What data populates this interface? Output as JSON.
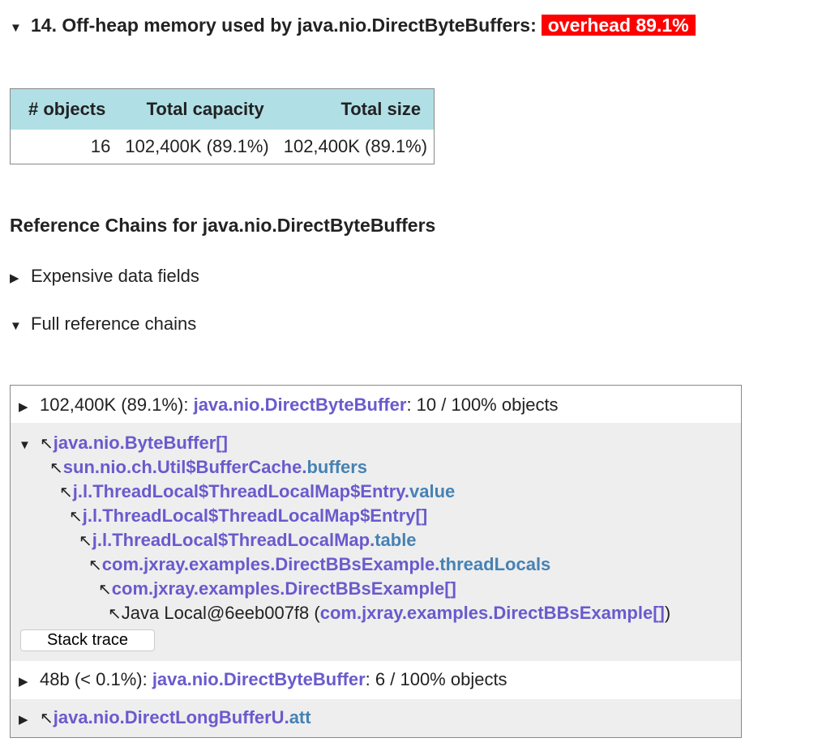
{
  "heading": {
    "title": "14. Off-heap memory used by java.nio.DirectByteBuffers:",
    "badge": "overhead 89.1%"
  },
  "summary_table": {
    "headers": [
      "# objects",
      "Total capacity",
      "Total size"
    ],
    "row": [
      "16",
      "102,400K (89.1%)",
      "102,400K (89.1%)"
    ]
  },
  "ref_title": "Reference Chains for java.nio.DirectByteBuffers",
  "toggles": {
    "expensive": "Expensive data fields",
    "full": "Full reference chains"
  },
  "chains": {
    "row1": {
      "prefix": "102,400K (89.1%): ",
      "cls": "java.nio.DirectByteBuffer",
      "suffix": ": 10 / 100% objects"
    },
    "lines": [
      {
        "cls": "java.nio.ByteBuffer[]",
        "fld": ""
      },
      {
        "cls": "sun.nio.ch.Util$BufferCache.",
        "fld": "buffers"
      },
      {
        "cls": "j.l.ThreadLocal$ThreadLocalMap$Entry.",
        "fld": "value"
      },
      {
        "cls": "j.l.ThreadLocal$ThreadLocalMap$Entry[]",
        "fld": ""
      },
      {
        "cls": "j.l.ThreadLocal$ThreadLocalMap.",
        "fld": "table"
      },
      {
        "cls": "com.jxray.examples.DirectBBsExample.",
        "fld": "threadLocals"
      },
      {
        "cls": "com.jxray.examples.DirectBBsExample[]",
        "fld": ""
      }
    ],
    "root": {
      "text": "Java Local@6eeb007f8 (",
      "cls": "com.jxray.examples.DirectBBsExample[]",
      "close": ")"
    },
    "stack_trace": "Stack trace",
    "row2": {
      "prefix": "48b (< 0.1%): ",
      "cls": "java.nio.DirectByteBuffer",
      "suffix": ": 6 / 100% objects"
    },
    "row3": {
      "cls": "java.nio.DirectLongBufferU.",
      "fld": "att"
    }
  }
}
